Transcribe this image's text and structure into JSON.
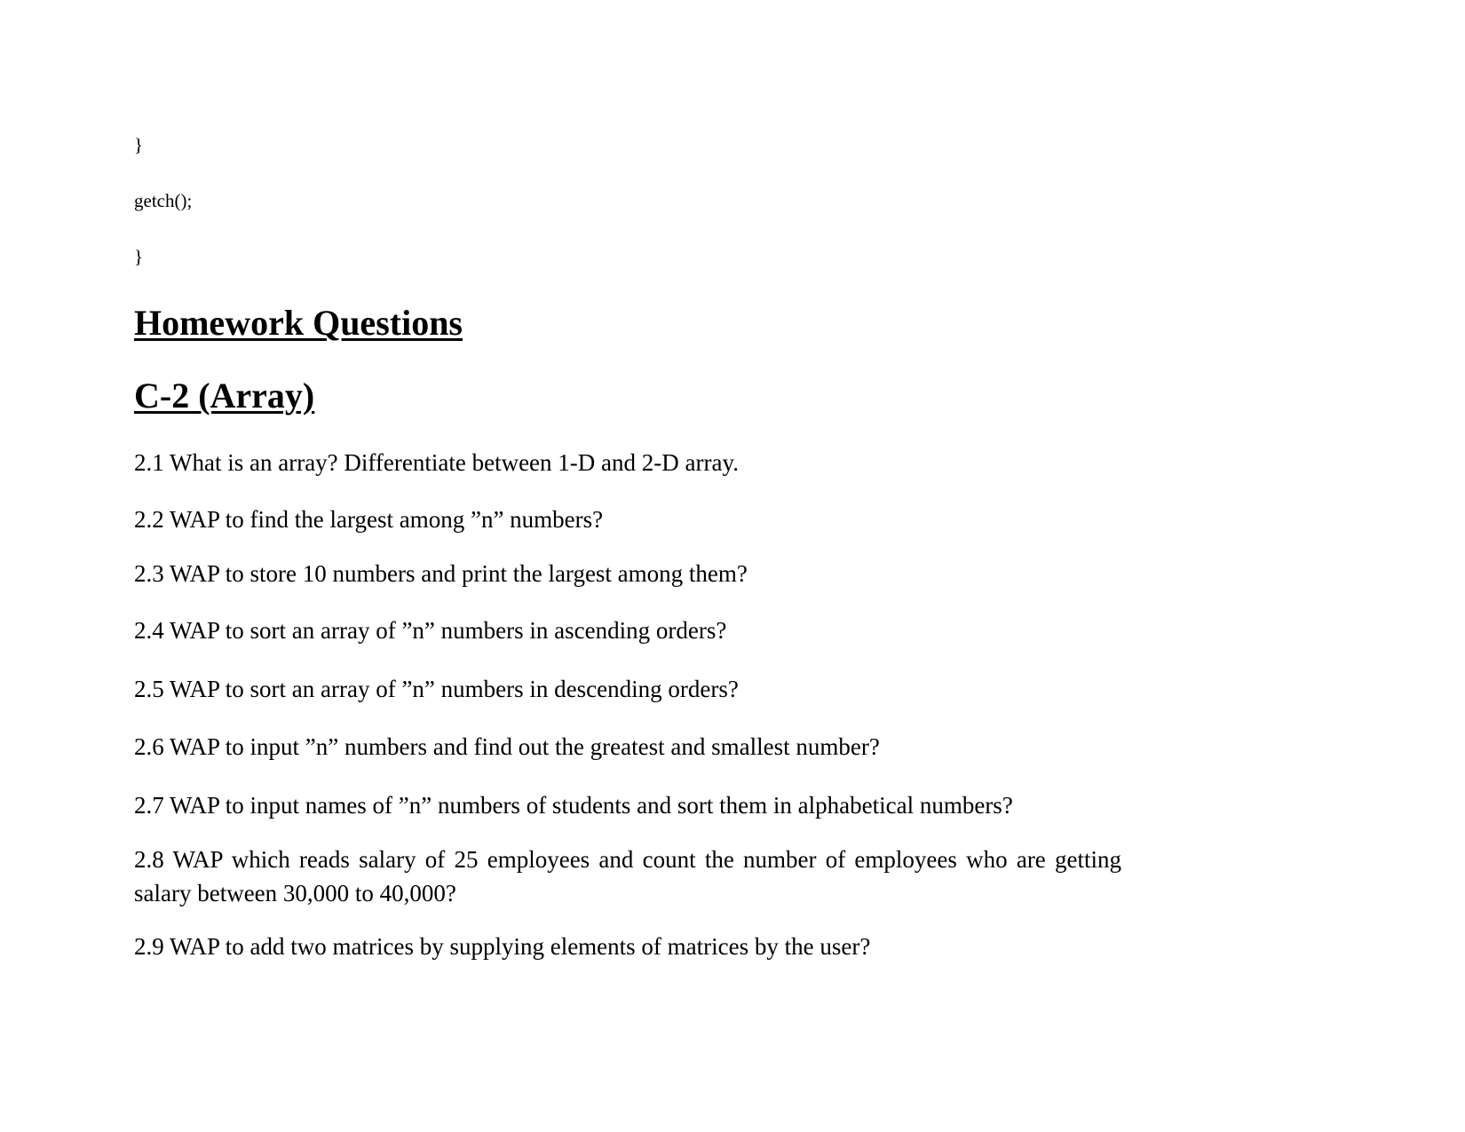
{
  "code": {
    "line1": "}",
    "line2": "getch();",
    "line3": "}"
  },
  "headings": {
    "homework": "Homework Questions",
    "section": "C-2 (Array)"
  },
  "questions": [
    "2.1 What is an array? Differentiate between 1-D and 2-D array.",
    "2.2 WAP to find the largest among ”n” numbers?",
    "2.3 WAP to store 10 numbers and print the largest among them?",
    "2.4 WAP to sort an array of ”n” numbers in ascending orders?",
    "2.5 WAP to sort an array of ”n” numbers in descending orders?",
    "2.6 WAP to input ”n” numbers and find out the greatest and smallest number?",
    "2.7 WAP to input names of ”n” numbers of students and sort them in alphabetical numbers?",
    "2.8 WAP which reads salary of 25 employees and count the number of employees who are getting salary between 30,000 to 40,000?",
    "2.9  WAP to add two matrices by supplying elements of matrices by the user?"
  ]
}
